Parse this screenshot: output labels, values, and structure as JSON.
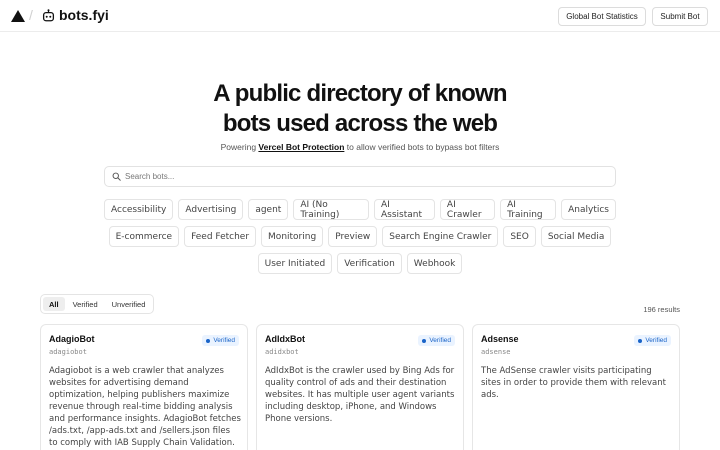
{
  "header": {
    "brand": "bots.fyi",
    "stats_button": "Global Bot Statistics",
    "submit_button": "Submit Bot"
  },
  "hero": {
    "title_line1": "A public directory of known",
    "title_line2": "bots used across the web",
    "subtitle_prefix": "Powering",
    "subtitle_link": "Vercel Bot Protection",
    "subtitle_suffix": "to allow verified bots to bypass bot filters"
  },
  "search": {
    "placeholder": "Search bots..."
  },
  "tags": [
    [
      "Accessibility",
      "Advertising",
      "agent",
      "AI (No Training)",
      "AI Assistant",
      "AI Crawler",
      "AI Training",
      "Analytics"
    ],
    [
      "E-commerce",
      "Feed Fetcher",
      "Monitoring",
      "Preview",
      "Search Engine Crawler",
      "SEO",
      "Social Media"
    ],
    [
      "User Initiated",
      "Verification",
      "Webhook"
    ]
  ],
  "filter": {
    "options": [
      "All",
      "Verified",
      "Unverified"
    ],
    "selected": "All"
  },
  "results": "196 results",
  "cards": [
    {
      "name": "AdagioBot",
      "id": "adagiobot",
      "badge": "Verified",
      "description": "Adagiobot is a web crawler that analyzes websites for advertising demand optimization, helping publishers maximize revenue through real-time bidding analysis and performance insights. AdagioBot fetches /ads.txt, /app-ads.txt and /sellers.json files to comply with IAB Supply Chain Validation."
    },
    {
      "name": "AdIdxBot",
      "id": "adidxbot",
      "badge": "Verified",
      "description": "AdIdxBot is the crawler used by Bing Ads for quality control of ads and their destination websites. It has multiple user agent variants including desktop, iPhone, and Windows Phone versions."
    },
    {
      "name": "Adsense",
      "id": "adsense",
      "badge": "Verified",
      "description": "The AdSense crawler visits participating sites in order to provide them with relevant ads."
    }
  ],
  "colors": {
    "accent": "#1a64c8",
    "badge_bg": "#eaf3ff",
    "border": "#e6e6e6"
  }
}
